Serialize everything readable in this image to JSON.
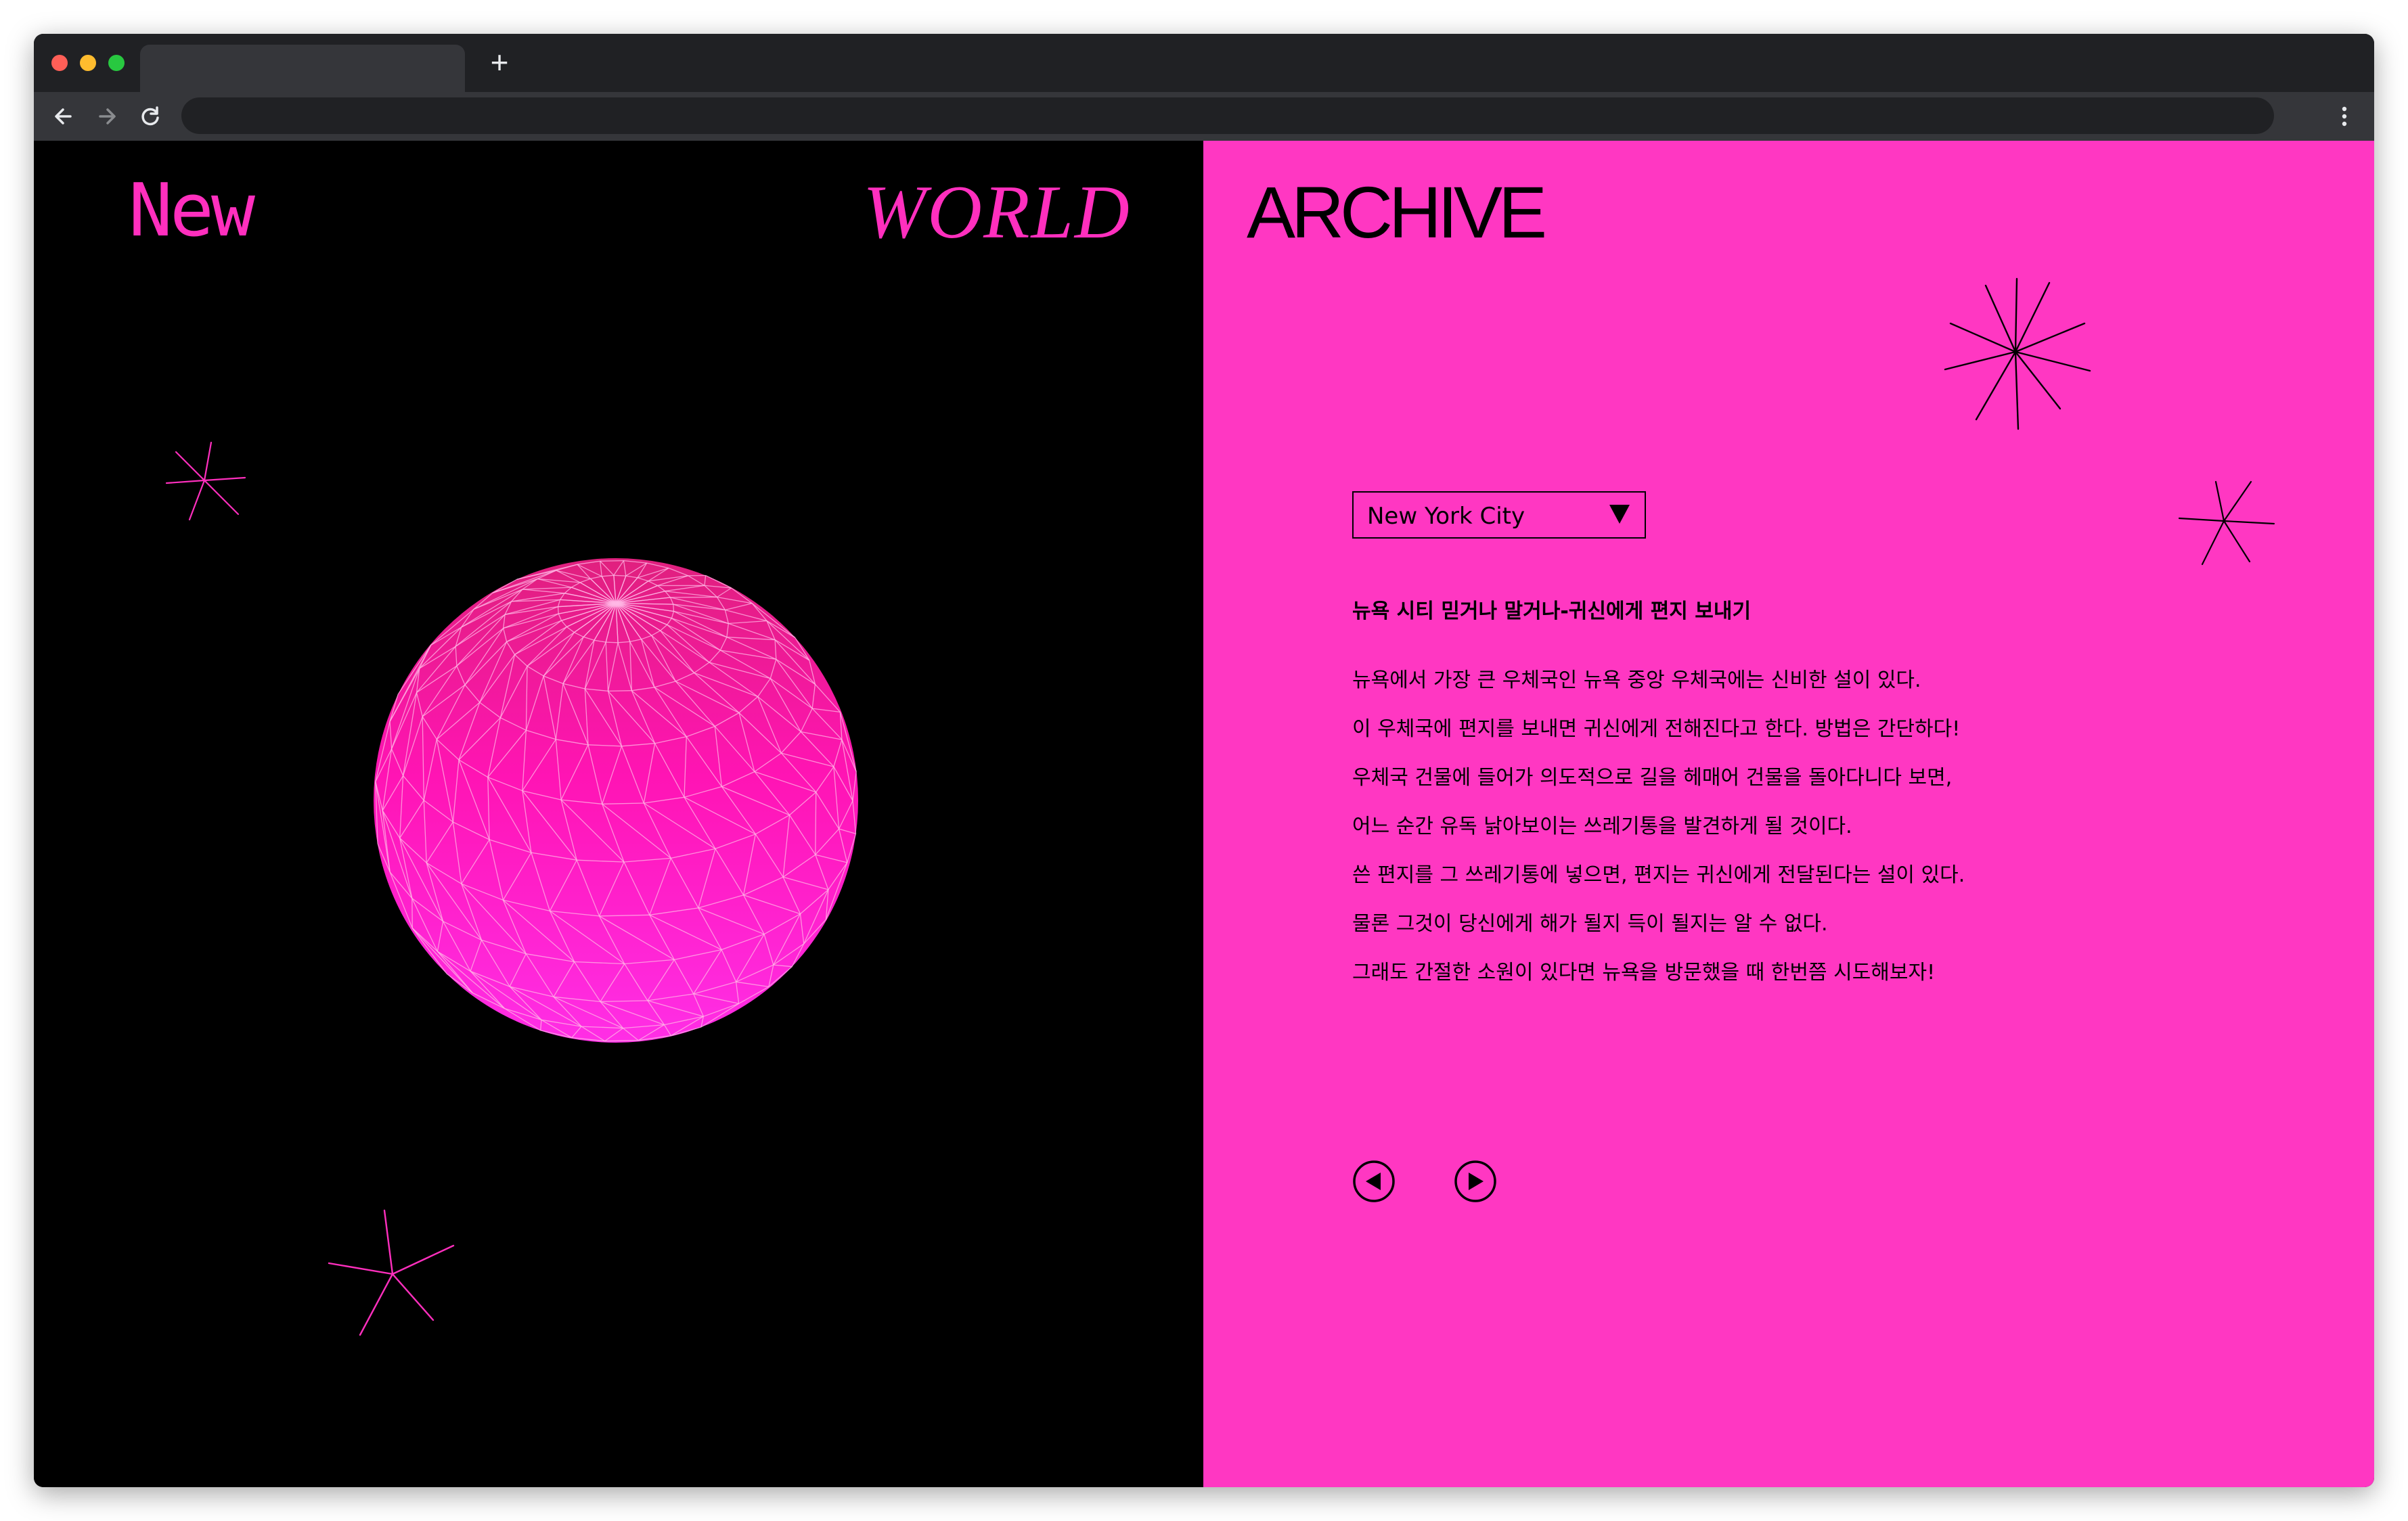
{
  "browser": {
    "new_tab_label": "+",
    "icons": [
      "back-arrow-icon",
      "forward-arrow-icon",
      "reload-icon",
      "more-vert-icon"
    ]
  },
  "brand": {
    "left": "New",
    "middle": "WORLD",
    "right": "ARCHIVE"
  },
  "city_select": {
    "selected": "New York City"
  },
  "story": {
    "title": "뉴욕 시티 믿거나 말거나-귀신에게 편지 보내기",
    "lines": [
      "뉴욕에서 가장 큰 우체국인 뉴욕 중앙 우체국에는 신비한 설이 있다.",
      "이 우체국에 편지를 보내면 귀신에게 전해진다고 한다. 방법은 간단하다!",
      "우체국 건물에 들어가 의도적으로 길을 헤매어 건물을 돌아다니다 보면,",
      "어느 순간 유독 낡아보이는 쓰레기통을 발견하게 될 것이다.",
      "쓴 편지를 그 쓰레기통에 넣으면, 편지는 귀신에게 전달된다는 설이 있다.",
      "물론 그것이 당신에게 해가 될지 득이 될지는 알 수 없다.",
      "그래도 간절한 소원이 있다면 뉴욕을 방문했을 때 한번쯤 시도해보자!"
    ]
  },
  "colors": {
    "accent": "#ff37c2",
    "brand_pink": "#ff2fbe",
    "background_dark": "#000000",
    "chrome": "#202124"
  }
}
